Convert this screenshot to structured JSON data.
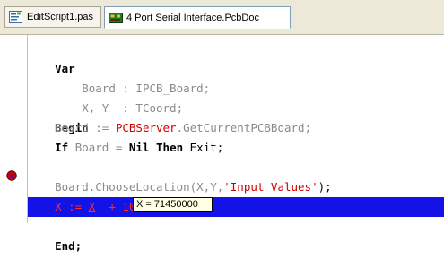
{
  "tabs": [
    {
      "label": "EditScript1.pas",
      "icon": "script-file-icon",
      "active": false
    },
    {
      "label": "4 Port Serial Interface.PcbDoc",
      "icon": "pcb-document-icon",
      "active": true
    }
  ],
  "code_lines": [
    {
      "tokens": [
        "Var"
      ]
    },
    {
      "tokens": [
        "    Board : IPCB_Board;"
      ]
    },
    {
      "tokens": [
        "    X, Y  : TCoord;"
      ]
    },
    {
      "tokens": [
        "Begin"
      ]
    },
    {
      "tokens": [
        "    Board := ",
        "PCBServer",
        ".GetCurrentPCBBoard;"
      ]
    },
    {
      "tokens": [
        "    ",
        "If",
        " Board = ",
        "Nil",
        " ",
        "Then",
        " Exit;"
      ]
    },
    {
      "tokens": [
        ""
      ]
    },
    {
      "tokens": [
        "    Board.ChooseLocation(X,Y,",
        "'Input Values'",
        ");"
      ]
    },
    {
      "tokens": [
        "    X := ",
        "X",
        "  + 10;"
      ]
    },
    {
      "tokens": [
        "End;"
      ]
    }
  ],
  "tooltip": {
    "text": "X = 71450000"
  },
  "colors": {
    "keyword": "#000000",
    "identifier": "#8a8a8a",
    "string": "#d00000",
    "execution_line_bg": "#1313e6",
    "breakpoint": "#d00000"
  }
}
